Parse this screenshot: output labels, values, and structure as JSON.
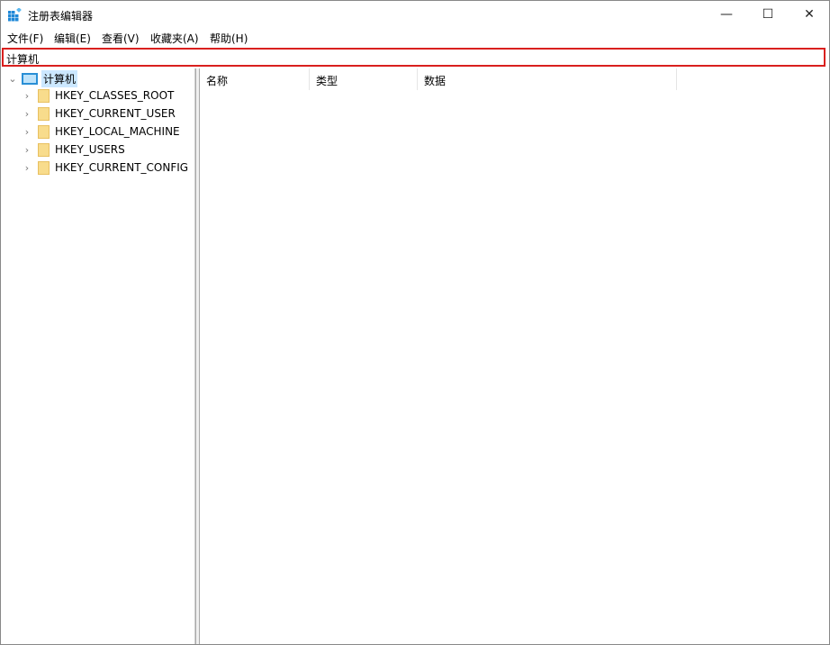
{
  "window": {
    "title": "注册表编辑器",
    "minimize": "—",
    "maximize": "☐",
    "close": "✕"
  },
  "menu": [
    "文件(F)",
    "编辑(E)",
    "查看(V)",
    "收藏夹(A)",
    "帮助(H)"
  ],
  "address": "计算机",
  "tree": {
    "root": "计算机",
    "keys": [
      "HKEY_CLASSES_ROOT",
      "HKEY_CURRENT_USER",
      "HKEY_LOCAL_MACHINE",
      "HKEY_USERS",
      "HKEY_CURRENT_CONFIG"
    ]
  },
  "columns": [
    "名称",
    "类型",
    "数据"
  ]
}
